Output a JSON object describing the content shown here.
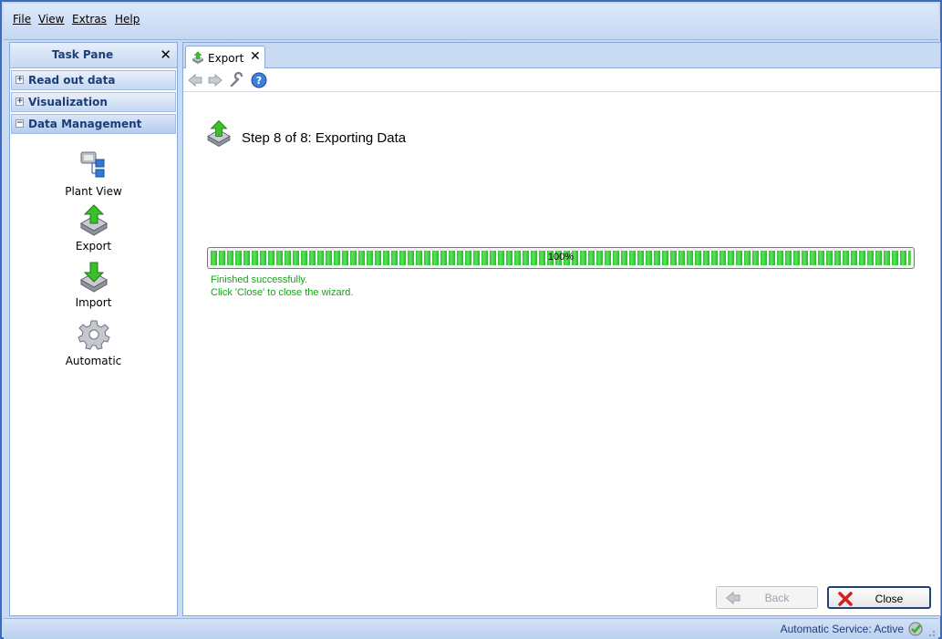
{
  "menu": {
    "items": [
      {
        "label": "File"
      },
      {
        "label": "View"
      },
      {
        "label": "Extras"
      },
      {
        "label": "Help"
      }
    ]
  },
  "task_pane": {
    "title": "Task Pane",
    "sections": [
      {
        "label": "Read out data",
        "expanded": false
      },
      {
        "label": "Visualization",
        "expanded": false
      },
      {
        "label": "Data Management",
        "expanded": true
      }
    ],
    "items": [
      {
        "label": "Plant View",
        "icon": "plant-view-icon"
      },
      {
        "label": "Export",
        "icon": "export-icon"
      },
      {
        "label": "Import",
        "icon": "import-icon"
      },
      {
        "label": "Automatic",
        "icon": "gear-icon"
      }
    ]
  },
  "tabs": [
    {
      "label": "Export",
      "active": true
    }
  ],
  "toolbar": {
    "buttons": [
      "back-arrow-icon",
      "forward-arrow-icon",
      "wrench-icon",
      "help-icon"
    ]
  },
  "wizard": {
    "step_title": "Step 8 of 8: Exporting Data",
    "progress_percent": 100,
    "progress_label": "100%",
    "status_lines": [
      "Finished successfully.",
      "Click 'Close' to close the wizard."
    ],
    "back_label": "Back",
    "close_label": "Close"
  },
  "status_bar": {
    "text": "Automatic Service: Active"
  },
  "colors": {
    "accent": "#3a6bc1",
    "progress_green": "#2fc52f",
    "status_green": "#17a317"
  }
}
